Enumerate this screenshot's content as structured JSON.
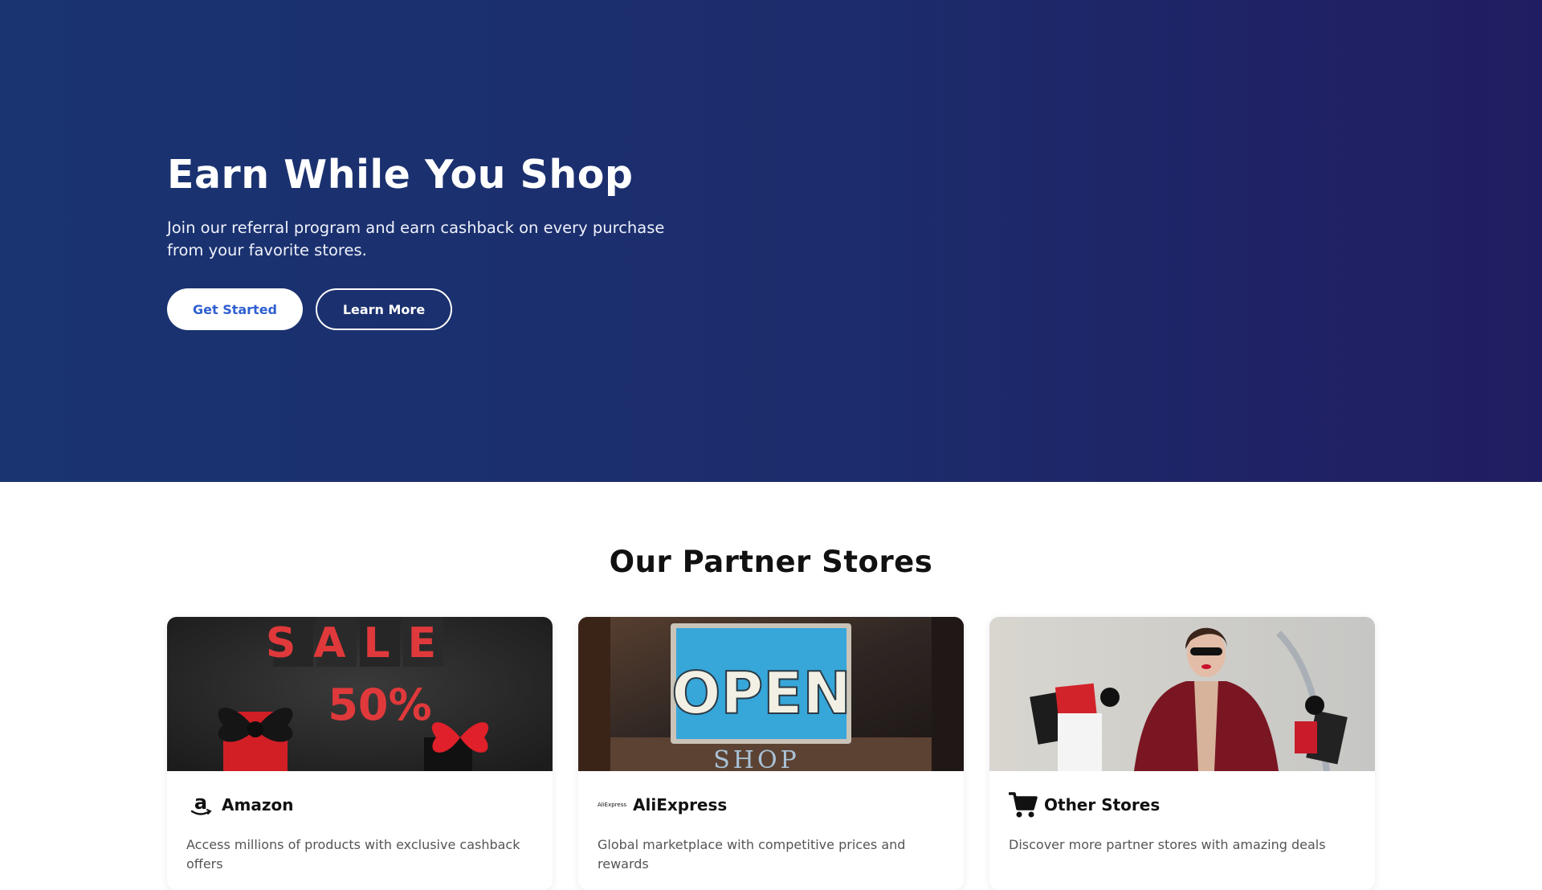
{
  "hero": {
    "title": "Earn While You Shop",
    "subtitle": "Join our referral program and earn cashback on every purchase from your favorite stores.",
    "primary_button": "Get Started",
    "secondary_button": "Learn More"
  },
  "partners": {
    "title": "Our Partner Stores",
    "cards": [
      {
        "name": "Amazon",
        "description": "Access millions of products with exclusive cashback offers",
        "icon": "amazon-logo-icon",
        "image": "sale-50-percent-gift-boxes-photo",
        "image_text": [
          "SALE",
          "50%"
        ]
      },
      {
        "name": "AliExpress",
        "description": "Global marketplace with competitive prices and rewards",
        "icon": "aliexpress-logo-icon",
        "icon_text": "AliExpress",
        "image": "open-shop-sign-photo",
        "image_text": [
          "OPEN",
          "SHOP"
        ]
      },
      {
        "name": "Other Stores",
        "description": "Discover more partner stores with amazing deals",
        "icon": "shopping-cart-icon",
        "image": "woman-with-shopping-bags-photo"
      }
    ]
  },
  "colors": {
    "hero_gradient_start": "#1a3471",
    "hero_gradient_end": "#211d62",
    "primary_button_text": "#2f5fd0",
    "sale_red": "#e0393b"
  }
}
